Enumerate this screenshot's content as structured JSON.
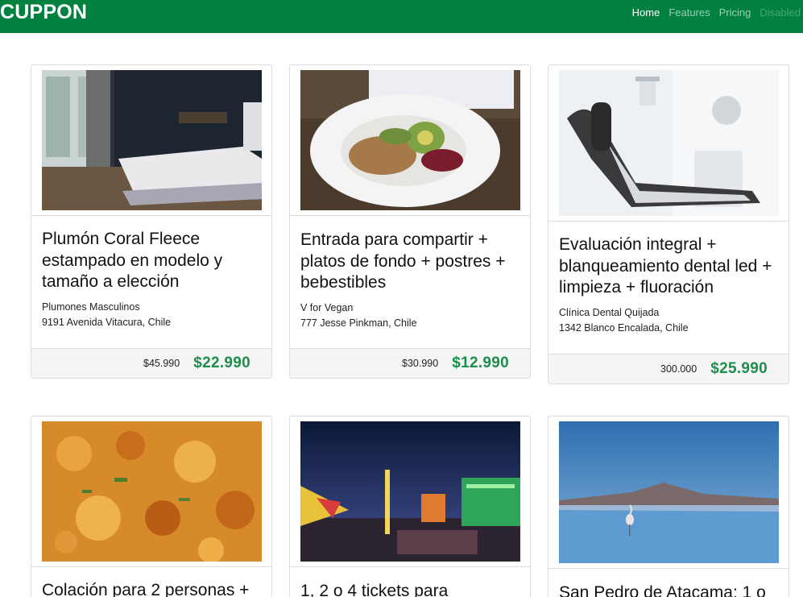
{
  "navbar": {
    "brand": "CUPPON",
    "links": [
      {
        "label": "Home",
        "state": "active"
      },
      {
        "label": "Features",
        "state": "normal"
      },
      {
        "label": "Pricing",
        "state": "normal"
      },
      {
        "label": "Disabled",
        "state": "disabled"
      }
    ],
    "color": "#00813f"
  },
  "accent_price_color": "#1e8e4d",
  "deals": [
    {
      "title": "Plumón Coral Fleece estampado en modelo y tamaño a elección",
      "merchant": "Plumones Masculinos",
      "address": "9191 Avenida Vitacura, Chile",
      "old_price": "$45.990",
      "price": "$22.990",
      "image": "bedroom-photo"
    },
    {
      "title": "Entrada para compartir + platos de fondo + postres + bebestibles",
      "merchant": "V for Vegan",
      "address": "777 Jesse Pinkman, Chile",
      "old_price": "$30.990",
      "price": "$12.990",
      "image": "vegan-bowl-photo"
    },
    {
      "title": "Evaluación integral + blanqueamiento dental led + limpieza + fluoración",
      "merchant": "Clínica Dental Quijada",
      "address": "1342 Blanco Encalada, Chile",
      "old_price": "300.000",
      "price": "$25.990",
      "image": "dental-chair-photo"
    },
    {
      "title": "Colación para 2 personas +",
      "merchant": "",
      "address": "",
      "old_price": "",
      "price": "",
      "image": "food-dish-photo"
    },
    {
      "title": "1, 2 o 4 tickets para",
      "merchant": "",
      "address": "",
      "old_price": "",
      "price": "",
      "image": "fair-rides-photo"
    },
    {
      "title": "San Pedro de Atacama: 1 o",
      "merchant": "",
      "address": "",
      "old_price": "",
      "price": "",
      "image": "lagoon-flamingo-photo"
    }
  ]
}
